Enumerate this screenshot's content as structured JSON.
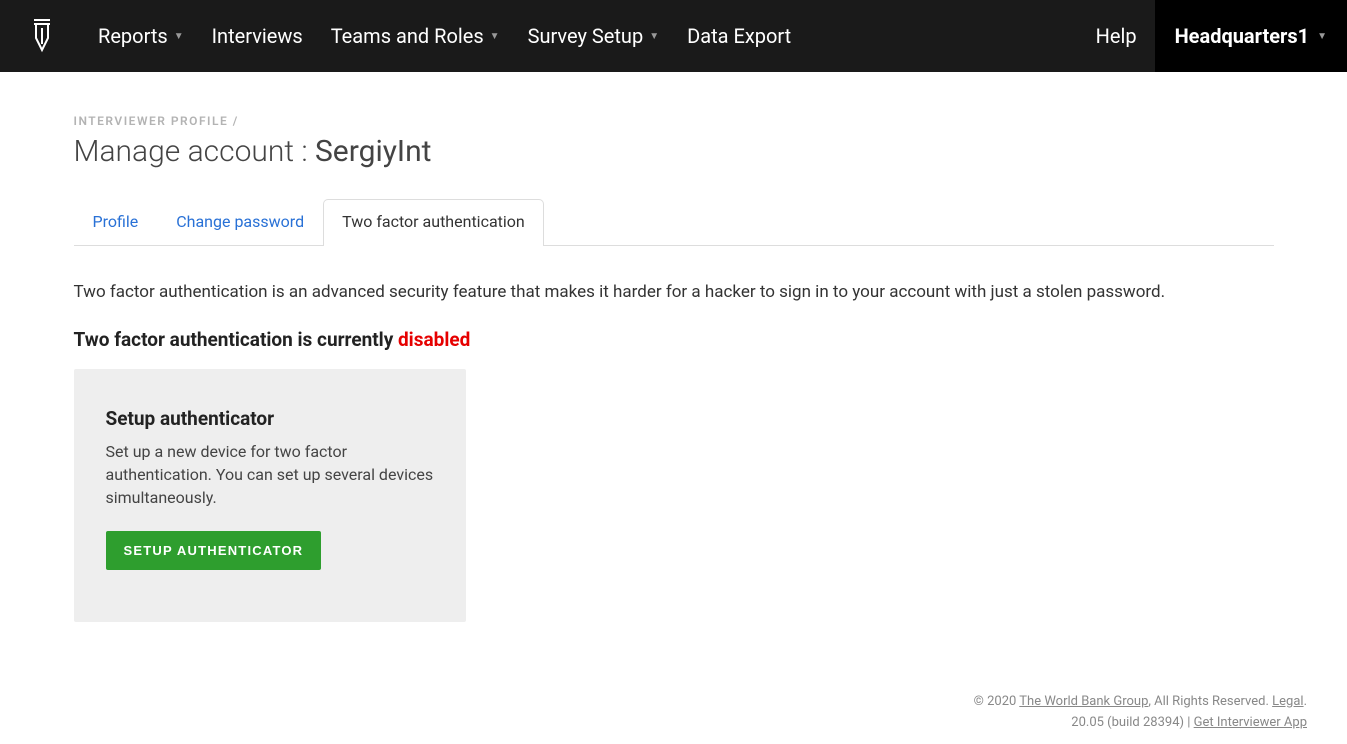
{
  "nav": {
    "items": [
      {
        "label": "Reports",
        "dropdown": true
      },
      {
        "label": "Interviews",
        "dropdown": false
      },
      {
        "label": "Teams and Roles",
        "dropdown": true
      },
      {
        "label": "Survey Setup",
        "dropdown": true
      },
      {
        "label": "Data Export",
        "dropdown": false
      }
    ],
    "help": "Help",
    "account": "Headquarters1"
  },
  "breadcrumb": "INTERVIEWER PROFILE /",
  "page_title_prefix": "Manage account : ",
  "page_title_username": "SergiyInt",
  "tabs": [
    {
      "label": "Profile",
      "active": false
    },
    {
      "label": "Change password",
      "active": false
    },
    {
      "label": "Two factor authentication",
      "active": true
    }
  ],
  "content": {
    "intro": "Two factor authentication is an advanced security feature that makes it harder for a hacker to sign in to your account with just a stolen password.",
    "status_prefix": "Two factor authentication is currently ",
    "status_value": "disabled",
    "card": {
      "title": "Setup authenticator",
      "desc": "Set up a new device for two factor authentication. You can set up several devices simultaneously.",
      "button": "SETUP AUTHENTICATOR"
    }
  },
  "footer": {
    "copyright_prefix": "© 2020 ",
    "org": "The World Bank Group",
    "rights": ", All Rights Reserved. ",
    "legal": "Legal",
    "legal_suffix": ".",
    "version": "20.05 (build 28394) | ",
    "app_link": "Get Interviewer App"
  }
}
